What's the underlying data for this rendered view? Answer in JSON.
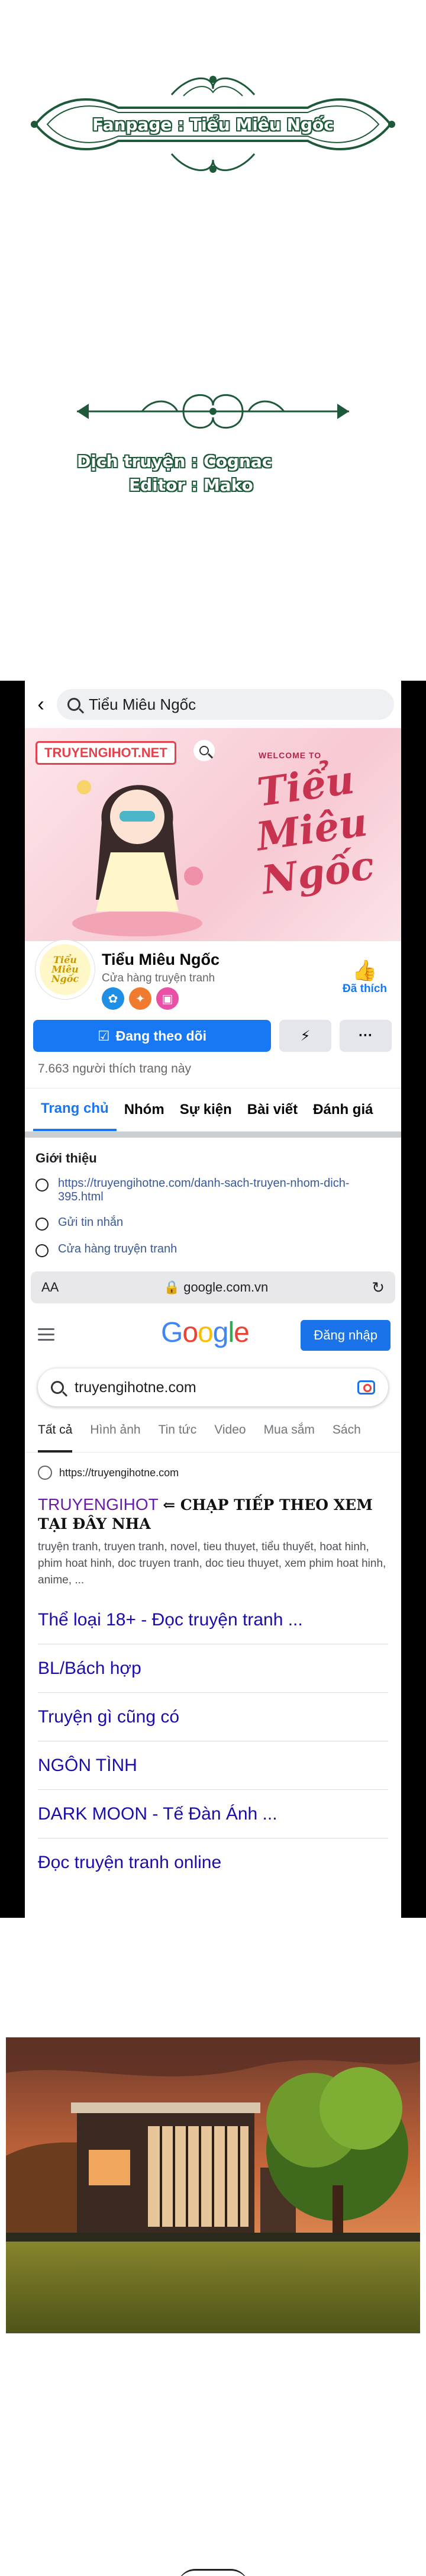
{
  "credits": {
    "fanpage_label": "Fanpage : Tiểu Miêu Ngốc",
    "translator_line": "Dịch truyện : Cognac",
    "editor_line": "Editor : Mako"
  },
  "facebook": {
    "search_query": "Tiểu Miêu Ngốc",
    "cover_brand": "TRUYENGIHOT.NET",
    "cover_welcome": "WELCOME TO",
    "cover_title": "Tiểu Miêu Ngốc",
    "page_name": "Tiểu Miêu Ngốc",
    "category": "Cửa hàng truyện tranh",
    "liked_label": "Đã thích",
    "follow_label": "Đang theo dõi",
    "more_label": "···",
    "likes_count": "7.663 người thích trang này",
    "tabs": [
      "Trang chủ",
      "Nhóm",
      "Sự kiện",
      "Bài viết",
      "Đánh giá"
    ],
    "intro_heading": "Giới thiệu",
    "intro_link": "https://truyengihotne.com/danh-sach-truyen-nhom-dich-395.html",
    "intro_message": "Gửi tin nhắn",
    "intro_category": "Cửa hàng truyện tranh"
  },
  "browser": {
    "aa_label": "AA",
    "url": "🔒 google.com.vn",
    "reload_icon": "↻"
  },
  "google": {
    "signin_label": "Đăng nhập",
    "search_value": "truyengihotne.com",
    "tabs": [
      "Tất cả",
      "Hình ảnh",
      "Tin tức",
      "Video",
      "Mua sắm",
      "Sách"
    ],
    "result_source": "https://truyengihotne.com",
    "result_title": "TRUYENGIHOT",
    "result_title_annotation": "⇐ CHẠP TIẾP THEO XEM TẠI ĐÂY NHA",
    "result_snippet": "truyện tranh, truyen tranh, novel, tieu thuyet, tiểu thuyết, hoat hinh, phim hoat hinh, doc truyen tranh, doc tieu thuyet, xem phim hoat hinh, anime, ...",
    "sitelinks": [
      "Thể loại 18+ - Đọc truyện tranh ...",
      "BL/Bách hợp",
      "Truyện gì cũng có",
      "NGÔN TÌNH",
      "DARK MOON - Tế Đàn Ánh ...",
      "Đọc truyện tranh online"
    ]
  },
  "colors": {
    "facebook_blue": "#1877f2",
    "google_blue": "#1a73e8",
    "credit_green": "#1e5a3a",
    "link_blue": "#1a0dab"
  }
}
